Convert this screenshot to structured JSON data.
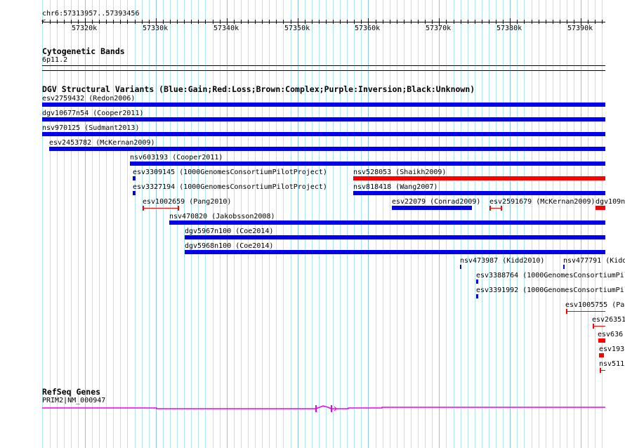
{
  "ruler": {
    "position_label": "chr6:57313957..57393456",
    "tick_labels": [
      "57320k",
      "57330k",
      "57340k",
      "57350k",
      "57360k",
      "57370k",
      "57380k",
      "57390k"
    ]
  },
  "cytoband": {
    "title": "Cytogenetic Bands",
    "band": "6p11.2"
  },
  "dgv": {
    "title": "DGV Structural Variants (Blue:Gain;Red:Loss;Brown:Complex;Purple:Inversion;Black:Unknown)",
    "colors": {
      "gain": "#0000ee",
      "loss": "#ff0000"
    },
    "features": [
      {
        "label": "esv2759432 (Redon2006)",
        "type": "gain"
      },
      {
        "label": "dgv10677n54 (Cooper2011)",
        "type": "gain"
      },
      {
        "label": "nsv970125 (Sudmant2013)",
        "type": "gain"
      },
      {
        "label": "esv2453782 (McKernan2009)",
        "type": "gain"
      },
      {
        "label": "nsv603193 (Cooper2011)",
        "type": "gain"
      },
      {
        "label": "esv3309145 (1000GenomesConsortiumPilotProject)",
        "type": "gain"
      },
      {
        "label": "nsv528053 (Shaikh2009)",
        "type": "loss"
      },
      {
        "label": "esv3327194 (1000GenomesConsortiumPilotProject)",
        "type": "gain"
      },
      {
        "label": "nsv818418 (Wang2007)",
        "type": "gain"
      },
      {
        "label": "esv1002659 (Pang2010)",
        "type": "loss"
      },
      {
        "label": "esv22079 (Conrad2009)",
        "type": "gain"
      },
      {
        "label": "esv2591679 (McKernan2009)",
        "type": "loss"
      },
      {
        "label": "dgv109n",
        "type": "loss"
      },
      {
        "label": "nsv470820 (Jakobsson2008)",
        "type": "gain"
      },
      {
        "label": "dgv5967n100 (Coe2014)",
        "type": "gain"
      },
      {
        "label": "dgv5968n100 (Coe2014)",
        "type": "gain"
      },
      {
        "label": "nsv473987 (Kidd2010)",
        "type": "gain"
      },
      {
        "label": "nsv477791 (Kidd",
        "type": "gain"
      },
      {
        "label": "esv3388764 (1000GenomesConsortiumPil",
        "type": "gain"
      },
      {
        "label": "esv3391992 (1000GenomesConsortiumPil",
        "type": "gain"
      },
      {
        "label": "esv1005755 (Pa",
        "type": "loss"
      },
      {
        "label": "esv26351",
        "type": "loss"
      },
      {
        "label": "esv636",
        "type": "loss"
      },
      {
        "label": "esv193",
        "type": "loss"
      },
      {
        "label": "nsv511",
        "type": "loss"
      }
    ]
  },
  "refseq": {
    "title": "RefSeq Genes",
    "gene": "PRIM2|NM_000947",
    "color": "#ee00ee"
  }
}
